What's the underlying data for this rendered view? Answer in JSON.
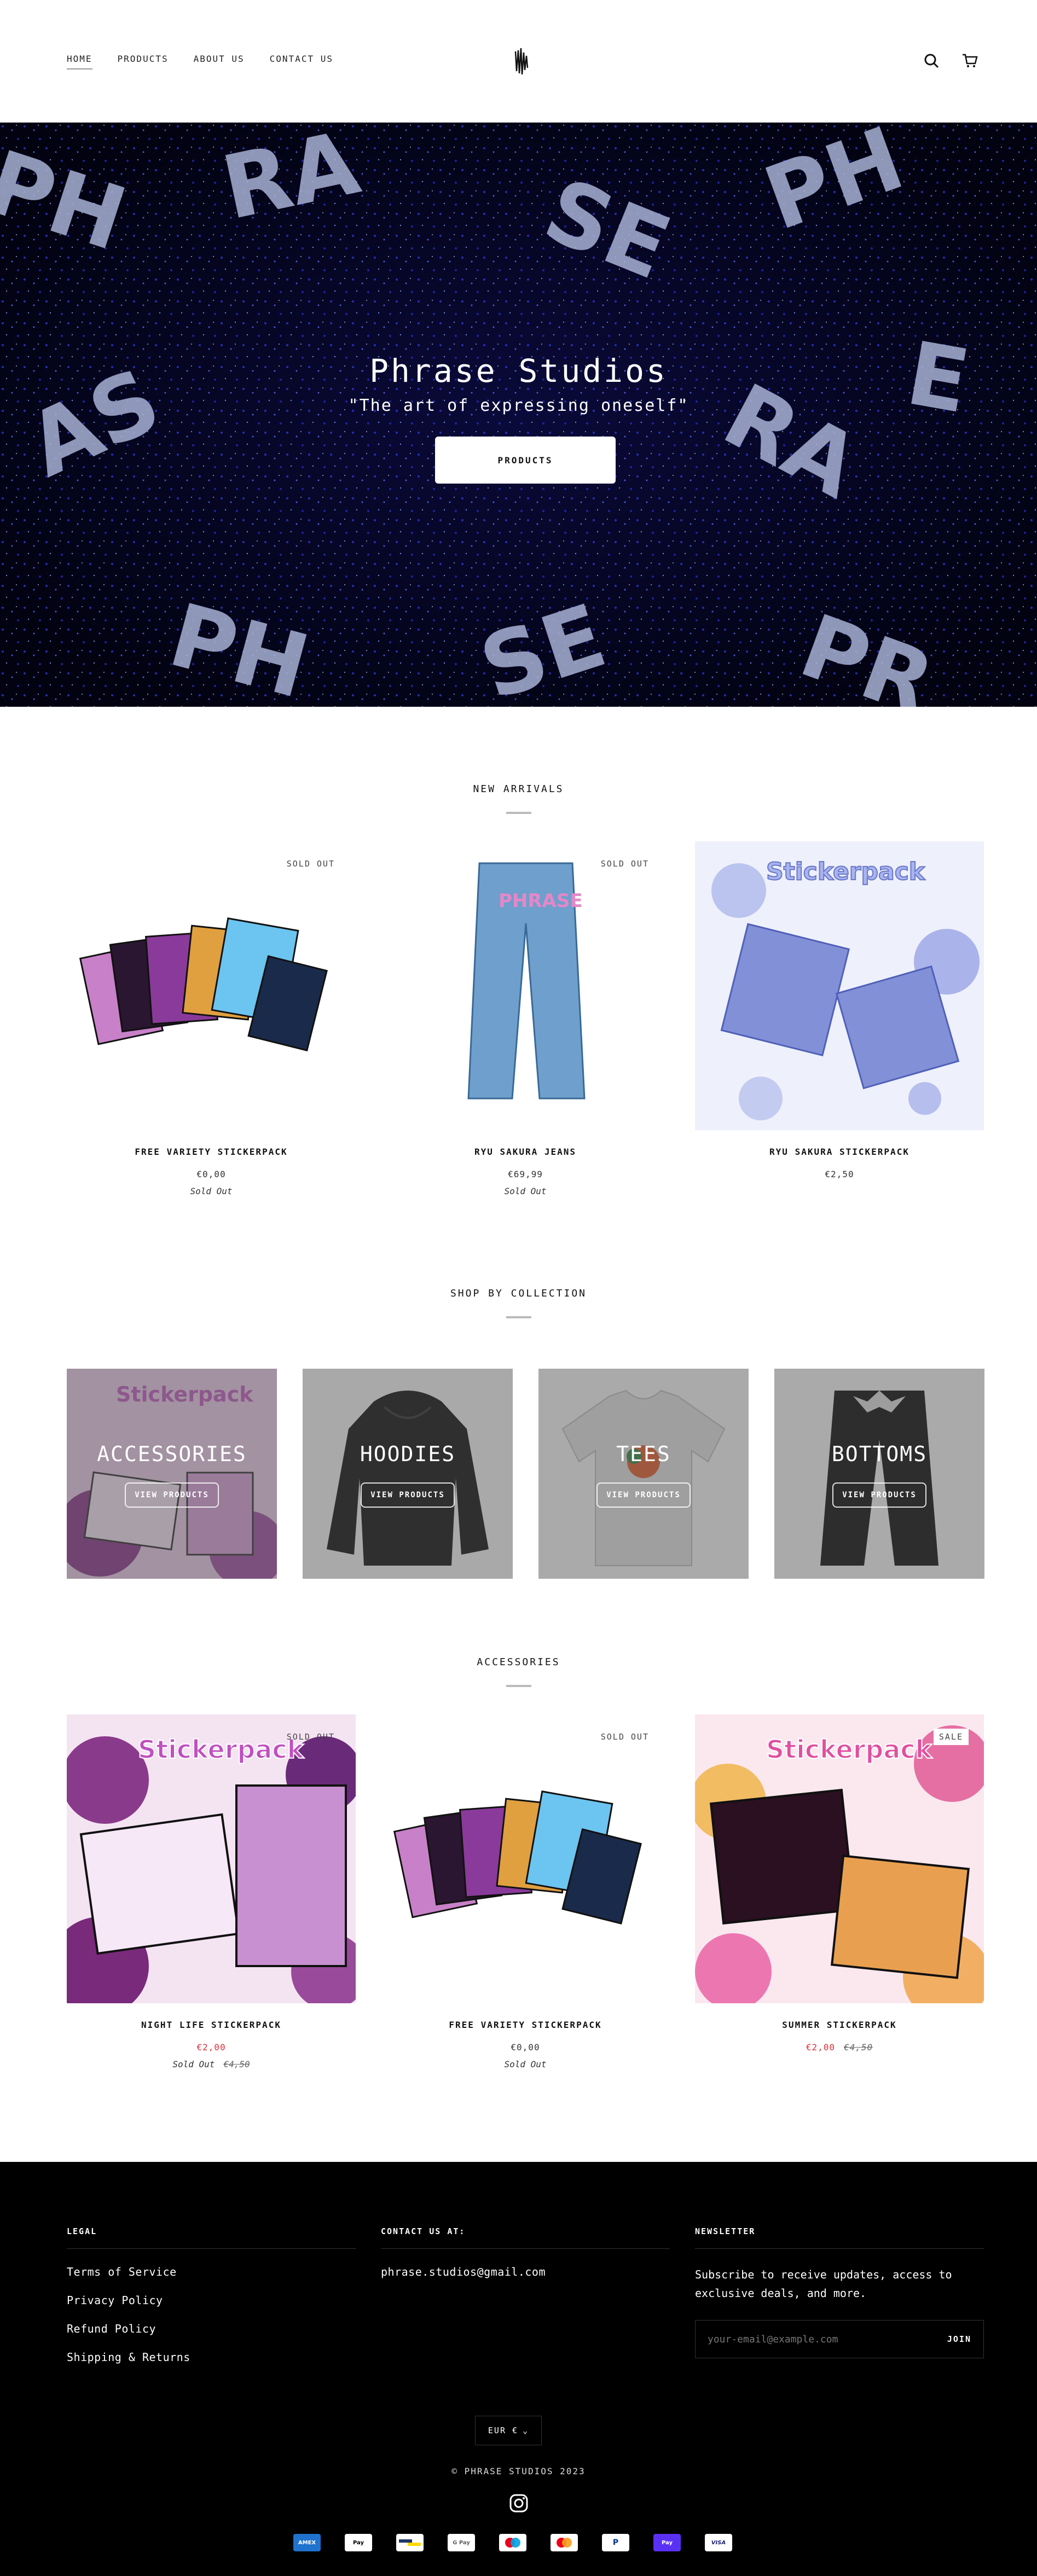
{
  "nav": {
    "items": [
      "HOME",
      "PRODUCTS",
      "ABOUT US",
      "CONTACT US"
    ]
  },
  "hero": {
    "title": "Phrase Studios",
    "subtitle": "\"The art of expressing oneself\"",
    "button": "PRODUCTS"
  },
  "new_arrivals": {
    "title": "NEW ARRIVALS",
    "products": [
      {
        "name": "FREE VARIETY STICKERPACK",
        "price": "€0,00",
        "status": "Sold Out",
        "badge": "SOLD OUT"
      },
      {
        "name": "RYU SAKURA JEANS",
        "price": "€69,99",
        "status": "Sold Out",
        "badge": "SOLD OUT"
      },
      {
        "name": "RYU SAKURA STICKERPACK",
        "price": "€2,50",
        "status": "",
        "badge": ""
      }
    ]
  },
  "collections": {
    "title": "SHOP BY COLLECTION",
    "items": [
      {
        "name": "ACCESSORIES",
        "button": "VIEW PRODUCTS"
      },
      {
        "name": "HOODIES",
        "button": "VIEW PRODUCTS"
      },
      {
        "name": "TEES",
        "button": "VIEW PRODUCTS"
      },
      {
        "name": "BOTTOMS",
        "button": "VIEW PRODUCTS"
      }
    ]
  },
  "accessories": {
    "title": "ACCESSORIES",
    "products": [
      {
        "name": "NIGHT LIFE STICKERPACK",
        "price": "€2,00",
        "status": "Sold Out",
        "compare": "€4,50",
        "badge": "SOLD OUT"
      },
      {
        "name": "FREE VARIETY STICKERPACK",
        "price": "€0,00",
        "status": "Sold Out",
        "compare": "",
        "badge": "SOLD OUT"
      },
      {
        "name": "SUMMER STICKERPACK",
        "price": "€2,00",
        "status": "",
        "compare": "€4,50",
        "badge": "SALE"
      }
    ]
  },
  "footer": {
    "legal_title": "LEGAL",
    "legal_links": [
      "Terms of Service",
      "Privacy Policy",
      "Refund Policy",
      "Shipping & Returns"
    ],
    "contact_title": "CONTACT US AT:",
    "contact_email": "phrase.studios@gmail.com",
    "newsletter_title": "NEWSLETTER",
    "newsletter_text": "Subscribe to receive updates, access to exclusive deals, and more.",
    "newsletter_placeholder": "your-email@example.com",
    "newsletter_button": "JOIN",
    "currency": "EUR €",
    "copyright": "© PHRASE STUDIOS 2023",
    "payments": [
      "AMEX",
      "Pay",
      "",
      "G Pay",
      "",
      "",
      "P",
      "Pay",
      "VISA"
    ]
  }
}
